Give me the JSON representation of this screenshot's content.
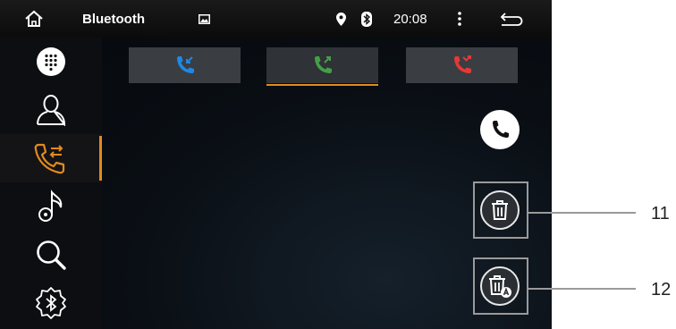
{
  "status_bar": {
    "title": "Bluetooth",
    "time": "20:08",
    "icons": [
      "home-icon",
      "gallery-icon",
      "location-icon",
      "bluetooth-icon",
      "more-vert-icon",
      "back-icon"
    ]
  },
  "sidebar": {
    "items": [
      {
        "icon": "dialpad-icon",
        "active": false
      },
      {
        "icon": "contacts-icon",
        "active": false
      },
      {
        "icon": "call-log-icon",
        "active": true
      },
      {
        "icon": "music-icon",
        "active": false
      },
      {
        "icon": "search-icon",
        "active": false
      },
      {
        "icon": "bluetooth-settings-icon",
        "active": false
      }
    ]
  },
  "tabs": [
    {
      "icon": "incoming-call-icon",
      "color": "#1e88e5",
      "active": false
    },
    {
      "icon": "outgoing-call-icon",
      "color": "#43a047",
      "active": true
    },
    {
      "icon": "missed-call-icon",
      "color": "#e53935",
      "active": false
    }
  ],
  "actions": {
    "call": "phone-icon",
    "delete": "trash-icon",
    "delete_all": "trash-all-icon"
  },
  "callouts": {
    "label_11": "11",
    "label_12": "12"
  },
  "colors": {
    "accent": "#e38a1e",
    "incoming": "#1e88e5",
    "outgoing": "#43a047",
    "missed": "#e53935"
  }
}
